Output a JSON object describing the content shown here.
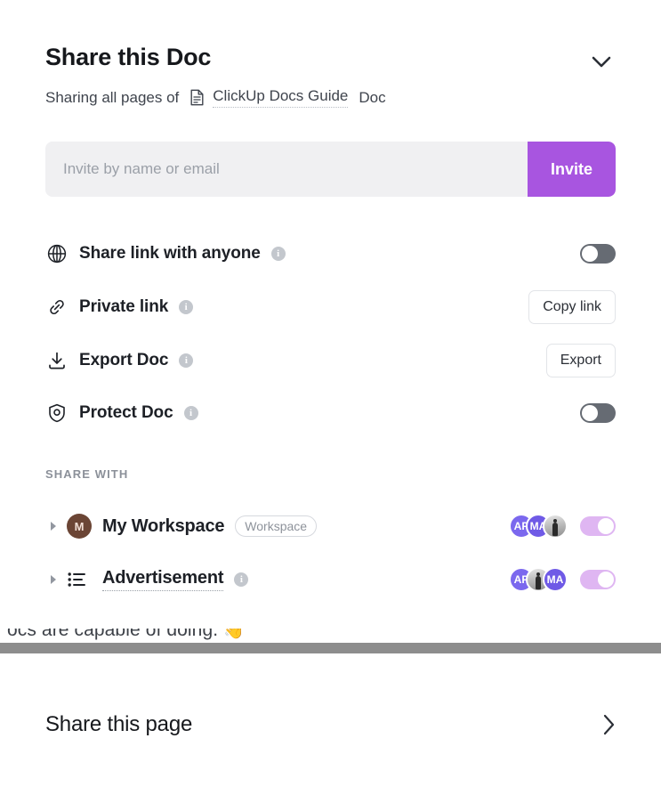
{
  "header": {
    "title": "Share this Doc",
    "subtitle_prefix": "Sharing all pages of",
    "doc_icon": "doc-page-icon",
    "doc_name": "ClickUp Docs Guide",
    "subtitle_suffix": "Doc",
    "collapse_icon": "chevron-down-icon"
  },
  "invite": {
    "placeholder": "Invite by name or email",
    "value": "",
    "button_label": "Invite",
    "button_color": "#a855e0"
  },
  "options": [
    {
      "icon": "globe-icon",
      "label": "Share link with anyone",
      "info": "i",
      "control": "toggle",
      "toggle_state": "off"
    },
    {
      "icon": "link-icon",
      "label": "Private link",
      "info": "i",
      "control": "button",
      "button_label": "Copy link"
    },
    {
      "icon": "download-icon",
      "label": "Export Doc",
      "info": "i",
      "control": "button",
      "button_label": "Export"
    },
    {
      "icon": "shield-icon",
      "label": "Protect Doc",
      "info": "i",
      "control": "toggle",
      "toggle_state": "off"
    }
  ],
  "share_with": {
    "section_label": "SHARE WITH",
    "rows": [
      {
        "caret": "caret-right-icon",
        "icon": "workspace-avatar",
        "avatar_initial": "M",
        "avatar_color": "#6b4535",
        "name": "My Workspace",
        "badge": "Workspace",
        "has_info": false,
        "dotted_name": false,
        "avatars": [
          {
            "type": "initials",
            "label": "AP",
            "color": "#7b68ee"
          },
          {
            "type": "initials",
            "label": "MA",
            "color": "#6f5ae6"
          },
          {
            "type": "photo",
            "label": ""
          }
        ],
        "toggle_state": "on-muted"
      },
      {
        "caret": "caret-right-icon",
        "icon": "list-icon",
        "avatar_initial": "",
        "avatar_color": "",
        "name": "Advertisement",
        "badge": "",
        "has_info": true,
        "info": "i",
        "dotted_name": true,
        "avatars": [
          {
            "type": "initials",
            "label": "AP",
            "color": "#7b68ee"
          },
          {
            "type": "photo",
            "label": ""
          },
          {
            "type": "initials",
            "label": "MA",
            "color": "#6f5ae6"
          }
        ],
        "toggle_state": "on-muted"
      }
    ]
  },
  "background": {
    "bleed_text": "ocs are capable of doing.",
    "bleed_emoji": "👋"
  },
  "share_page": {
    "label": "Share this page",
    "chevron": "chevron-right-icon"
  }
}
